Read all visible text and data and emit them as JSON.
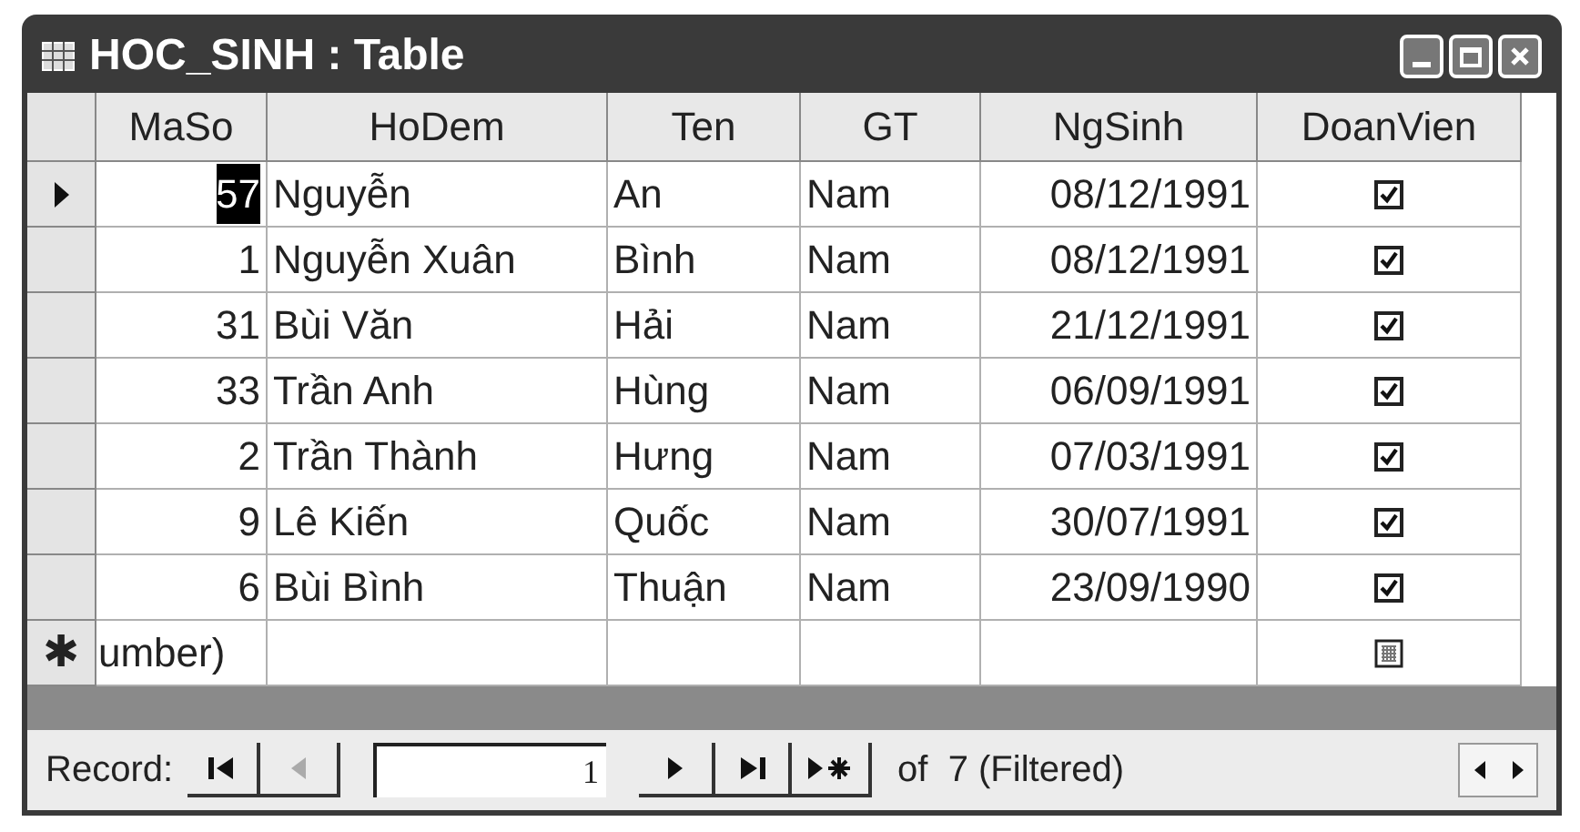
{
  "window": {
    "title": "HOC_SINH : Table"
  },
  "columns": [
    "MaSo",
    "HoDem",
    "Ten",
    "GT",
    "NgSinh",
    "DoanVien"
  ],
  "rows": [
    {
      "selected": true,
      "maso": "57",
      "hodem": "Nguyễn",
      "ten": "An",
      "gt": "Nam",
      "ngsinh": "08/12/1991",
      "doanvien": true
    },
    {
      "selected": false,
      "maso": "1",
      "hodem": "Nguyễn Xuân",
      "ten": "Bình",
      "gt": "Nam",
      "ngsinh": "08/12/1991",
      "doanvien": true
    },
    {
      "selected": false,
      "maso": "31",
      "hodem": "Bùi Văn",
      "ten": "Hải",
      "gt": "Nam",
      "ngsinh": "21/12/1991",
      "doanvien": true
    },
    {
      "selected": false,
      "maso": "33",
      "hodem": "Trần Anh",
      "ten": "Hùng",
      "gt": "Nam",
      "ngsinh": "06/09/1991",
      "doanvien": true
    },
    {
      "selected": false,
      "maso": "2",
      "hodem": "Trần Thành",
      "ten": "Hưng",
      "gt": "Nam",
      "ngsinh": "07/03/1991",
      "doanvien": true
    },
    {
      "selected": false,
      "maso": "9",
      "hodem": "Lê Kiến",
      "ten": "Quốc",
      "gt": "Nam",
      "ngsinh": "30/07/1991",
      "doanvien": true
    },
    {
      "selected": false,
      "maso": "6",
      "hodem": "Bùi Bình",
      "ten": "Thuận",
      "gt": "Nam",
      "ngsinh": "23/09/1990",
      "doanvien": true
    }
  ],
  "new_row": {
    "marker": "✱",
    "maso": "umber)"
  },
  "navigation": {
    "label": "Record:",
    "record_number": "1",
    "count": "of  7 (Filtered)",
    "previous_disabled": true
  }
}
